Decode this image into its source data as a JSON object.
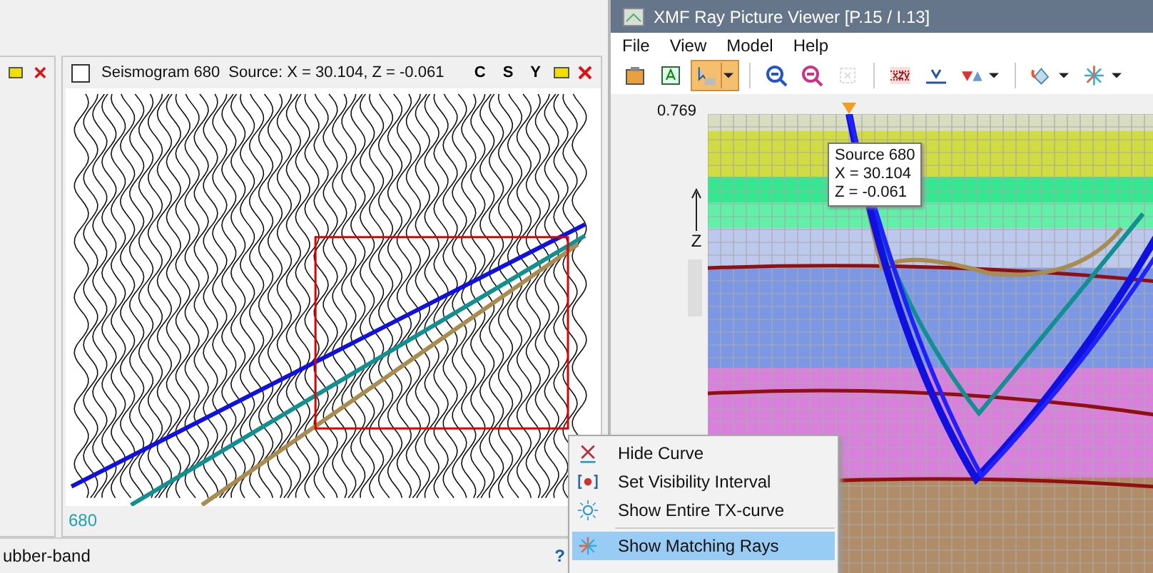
{
  "seismogram_panel": {
    "checked": false,
    "title": "Seismogram 680",
    "source": "Source: X = 30.104,  Z = -0.061",
    "buttons": [
      "C",
      "S",
      "Y"
    ],
    "footer": "680"
  },
  "status_bar": {
    "text": "ubber-band",
    "help": "?"
  },
  "viewer": {
    "title": "XMF Ray Picture Viewer  [P.15 / I.13]",
    "menu": [
      "File",
      "View",
      "Model",
      "Help"
    ],
    "toolbar": [
      {
        "kind": "clipboard",
        "selected": false,
        "dropdown": false,
        "disabled": false
      },
      {
        "kind": "text",
        "selected": false,
        "dropdown": false,
        "disabled": false
      },
      {
        "kind": "pointer",
        "selected": true,
        "dropdown": true,
        "disabled": false
      },
      {
        "kind": "zoom-in",
        "selected": false,
        "dropdown": false,
        "disabled": false
      },
      {
        "kind": "zoom-out",
        "selected": false,
        "dropdown": false,
        "disabled": false
      },
      {
        "kind": "fit",
        "selected": false,
        "dropdown": false,
        "disabled": true
      },
      {
        "kind": "xzv",
        "selected": false,
        "dropdown": false,
        "disabled": false
      },
      {
        "kind": "axis",
        "selected": false,
        "dropdown": false,
        "disabled": false
      },
      {
        "kind": "triangles",
        "selected": false,
        "dropdown": true,
        "disabled": false
      },
      {
        "kind": "fill",
        "selected": false,
        "dropdown": true,
        "disabled": false
      },
      {
        "kind": "star",
        "selected": false,
        "dropdown": true,
        "disabled": false
      }
    ],
    "axis_value": "0.769",
    "axis_label": "Z",
    "tooltip": [
      "Source 680",
      "X = 30.104",
      "Z = -0.061"
    ]
  },
  "context_menu": [
    {
      "kind": "cross",
      "label": "Hide Curve",
      "selected": false
    },
    {
      "kind": "interval",
      "label": "Set Visibility Interval",
      "selected": false
    },
    {
      "kind": "sun",
      "label": "Show Entire TX-curve",
      "selected": false
    },
    {
      "kind": "separator"
    },
    {
      "kind": "star",
      "label": "Show Matching Rays",
      "selected": true
    }
  ]
}
